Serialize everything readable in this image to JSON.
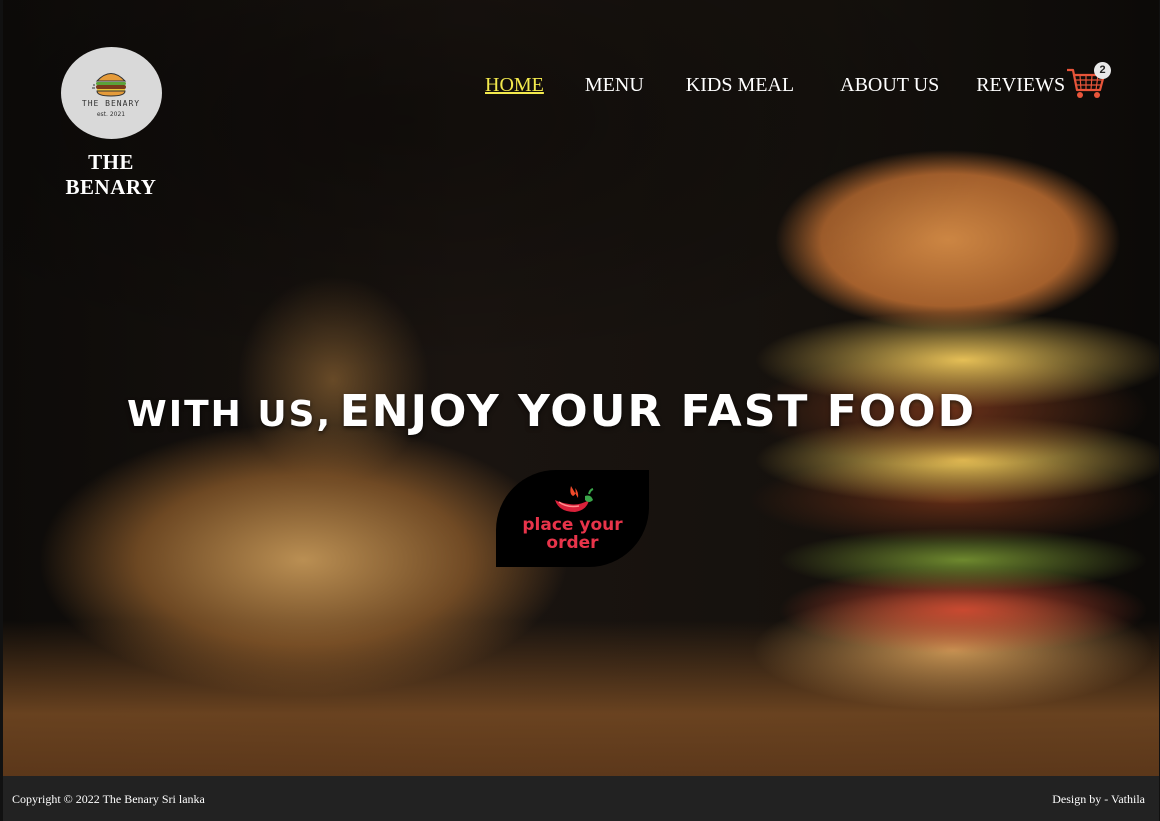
{
  "brand": {
    "logo_name": "THE BENARY",
    "logo_est": "est. 2021",
    "title": "THE BENARY"
  },
  "nav": {
    "items": [
      {
        "label": "HOME",
        "active": true
      },
      {
        "label": "MENU",
        "active": false
      },
      {
        "label": "KIDS MEAL",
        "active": false
      },
      {
        "label": "ABOUT US",
        "active": false
      },
      {
        "label": "REVIEWS",
        "active": false
      }
    ],
    "cart_icon": "shopping-cart-icon",
    "cart_count": "2"
  },
  "hero": {
    "headline_small": "with us,",
    "headline_big": "ENJOY YOUR FAST FOOD",
    "order_button_label": "place your order",
    "order_button_icon": "chili-pepper-icon"
  },
  "footer": {
    "copyright": "Copyright © 2022 The Benary Sri lanka",
    "designer": "Design by - Vathila"
  },
  "colors": {
    "nav_active": "#f3e94d",
    "order_text": "#e8344a",
    "footer_bg": "#222222",
    "cart": "#e8553a"
  }
}
